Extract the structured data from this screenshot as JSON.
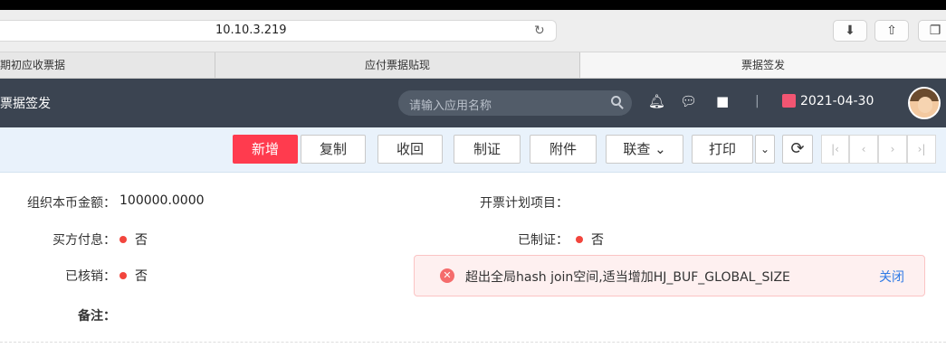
{
  "browser": {
    "url": "10.10.3.219",
    "reload_icon": "reload-icon",
    "download_icon": "download-icon",
    "share_icon": "share-icon",
    "tabs_icon": "tabs-icon"
  },
  "tabs": [
    {
      "label": "期初应收票据"
    },
    {
      "label": "应付票据贴现"
    },
    {
      "label": "票据签发"
    }
  ],
  "app": {
    "title": "票据签发",
    "search_placeholder": "请输入应用名称",
    "date": "2021-04-30",
    "separator": "|"
  },
  "toolbar": {
    "add_label": "新增",
    "copy_label": "复制",
    "recall_label": "收回",
    "voucher_label": "制证",
    "attach_label": "附件",
    "query_label": "联查 ⌄",
    "print_label": "打印",
    "print_more": "⌄",
    "refresh": "⟳",
    "first": "|‹",
    "prev": "‹",
    "next": "›",
    "last": "›|"
  },
  "form": {
    "org_amount_label": "组织本币金额：",
    "org_amount_value": "100000.0000",
    "plan_item_label": "开票计划项目：",
    "buyer_interest_label": "买方付息：",
    "buyer_interest_value": "否",
    "voucher_done_label": "已制证：",
    "voucher_done_value": "否",
    "verified_label": "已核销：",
    "verified_value": "否",
    "remark_label": "备注："
  },
  "toast": {
    "message": "超出全局hash join空间,适当增加HJ_BUF_GLOBAL_SIZE",
    "close_label": "关闭"
  },
  "colors": {
    "primary": "#ff3b4e",
    "header_bg": "#3b4451",
    "error": "#f56c6c",
    "link": "#2f7ae5"
  }
}
